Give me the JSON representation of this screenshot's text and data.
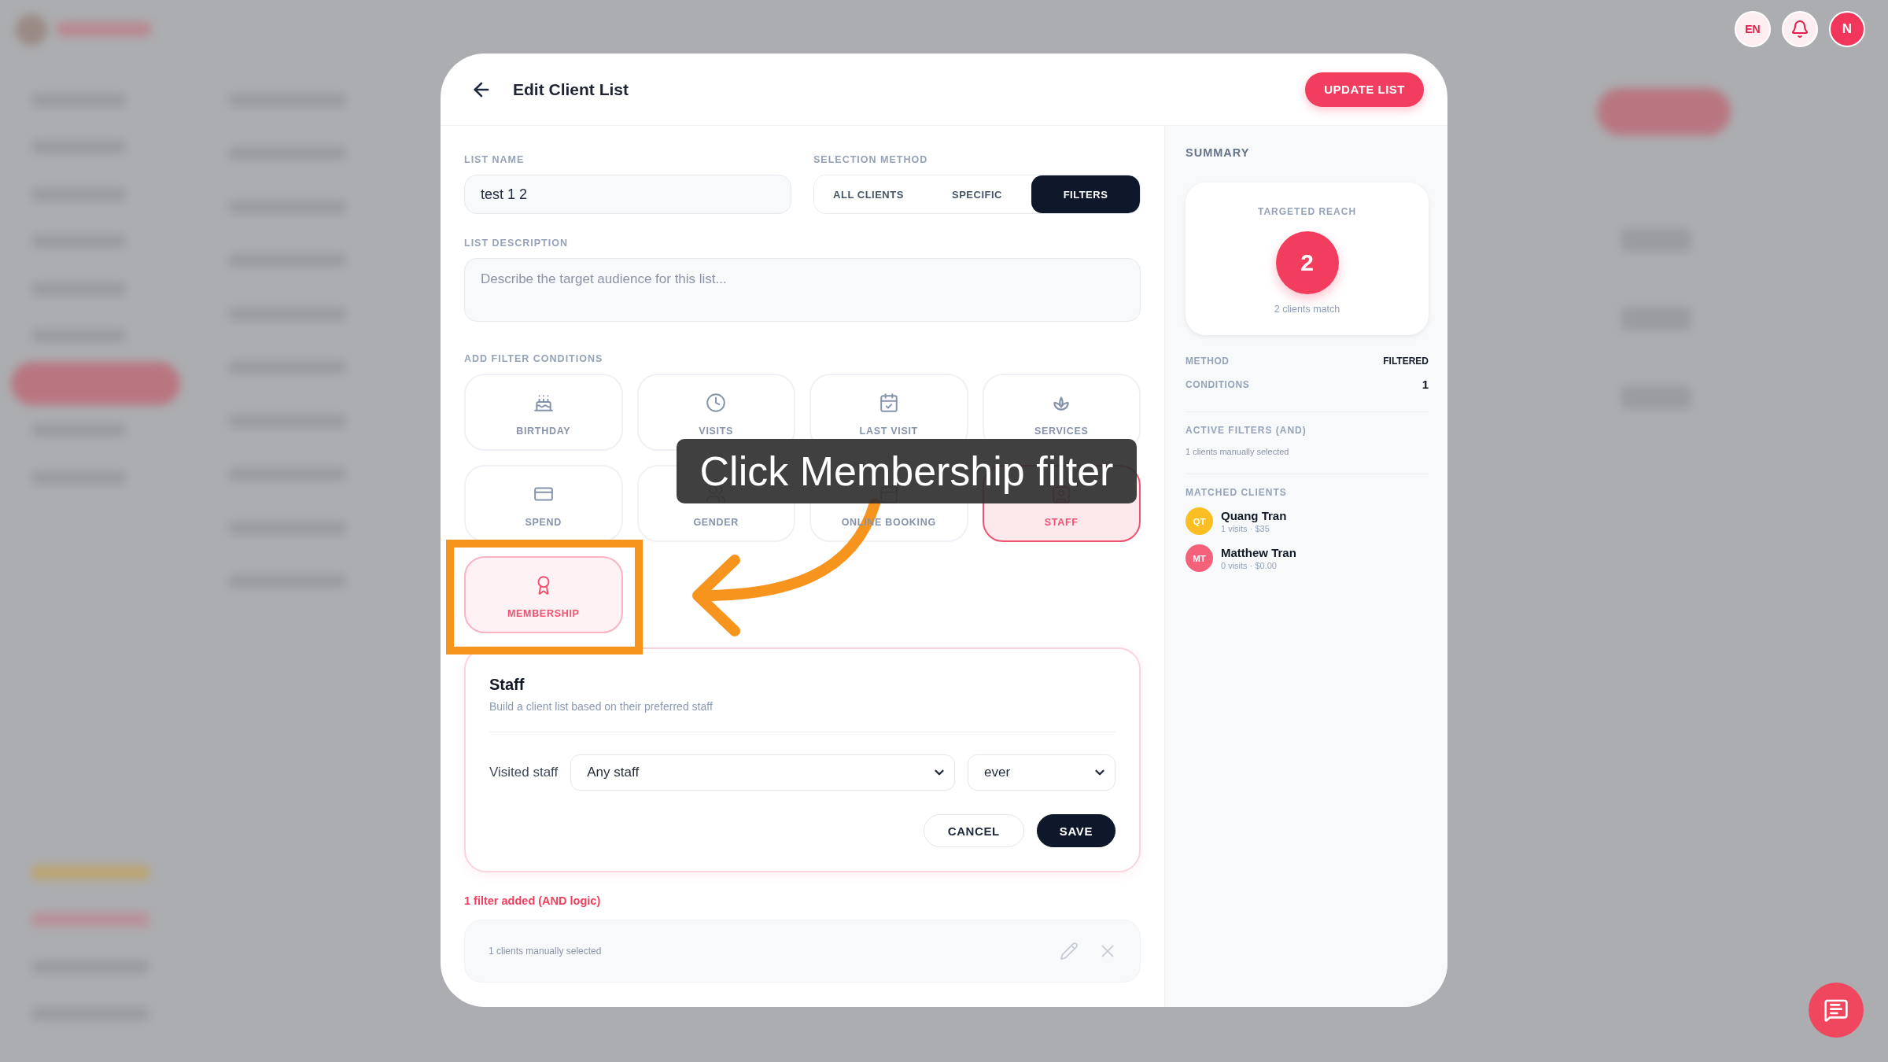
{
  "topbar": {
    "language": "EN",
    "avatar": "N"
  },
  "modal": {
    "title": "Edit Client List",
    "primary_button": "UPDATE LIST",
    "list_name": {
      "label": "LIST NAME",
      "value": "test 1 2"
    },
    "selection_method": {
      "label": "SELECTION METHOD",
      "options": [
        {
          "label": "ALL CLIENTS",
          "selected": false
        },
        {
          "label": "SPECIFIC",
          "selected": false
        },
        {
          "label": "FILTERS",
          "selected": true
        }
      ]
    },
    "list_description": {
      "label": "LIST DESCRIPTION",
      "placeholder": "Describe the target audience for this list..."
    },
    "filter_conditions": {
      "label": "ADD FILTER CONDITIONS",
      "items": [
        {
          "label": "BIRTHDAY",
          "selected": false,
          "hovered": false
        },
        {
          "label": "VISITS",
          "selected": false,
          "hovered": false
        },
        {
          "label": "LAST VISIT",
          "selected": false,
          "hovered": false
        },
        {
          "label": "SERVICES",
          "selected": false,
          "hovered": false
        },
        {
          "label": "SPEND",
          "selected": false,
          "hovered": false
        },
        {
          "label": "GENDER",
          "selected": false,
          "hovered": false
        },
        {
          "label": "ONLINE BOOKING",
          "selected": false,
          "hovered": false
        },
        {
          "label": "STAFF",
          "selected": true,
          "hovered": false
        },
        {
          "label": "MEMBERSHIP",
          "selected": false,
          "hovered": true
        }
      ]
    },
    "filter_editor": {
      "title": "Staff",
      "description": "Build a client list based on their preferred staff",
      "field_label": "Visited staff",
      "staff_select": "Any staff",
      "period_select": "ever",
      "buttons": [
        {
          "label": "CANCEL",
          "kind": "secondary"
        },
        {
          "label": "SAVE",
          "kind": "primary"
        }
      ]
    },
    "filters_added": "1 filter added (AND logic)",
    "added_filters": [
      {
        "text": "1 clients manually selected"
      }
    ]
  },
  "summary": {
    "title": "SUMMARY",
    "reach_label": "TARGETED REACH",
    "reach_count": "2",
    "reach_caption": "2 clients match",
    "stats": [
      {
        "label": "METHOD",
        "value": "FILTERED"
      },
      {
        "label": "CONDITIONS",
        "value": "1"
      }
    ],
    "active_filters_label": "ACTIVE FILTERS (AND)",
    "active_filters": [
      "1 clients manually selected"
    ],
    "matched_label": "MATCHED CLIENTS",
    "clients": [
      {
        "initials": "QT",
        "name": "Quang Tran",
        "detail": "1 visits · $35",
        "color": "#fbbf24"
      },
      {
        "initials": "MT",
        "name": "Matthew Tran",
        "detail": "0 visits · $0.00",
        "color": "#f5607a"
      }
    ]
  },
  "annotation": {
    "text": "Click Membership filter"
  }
}
